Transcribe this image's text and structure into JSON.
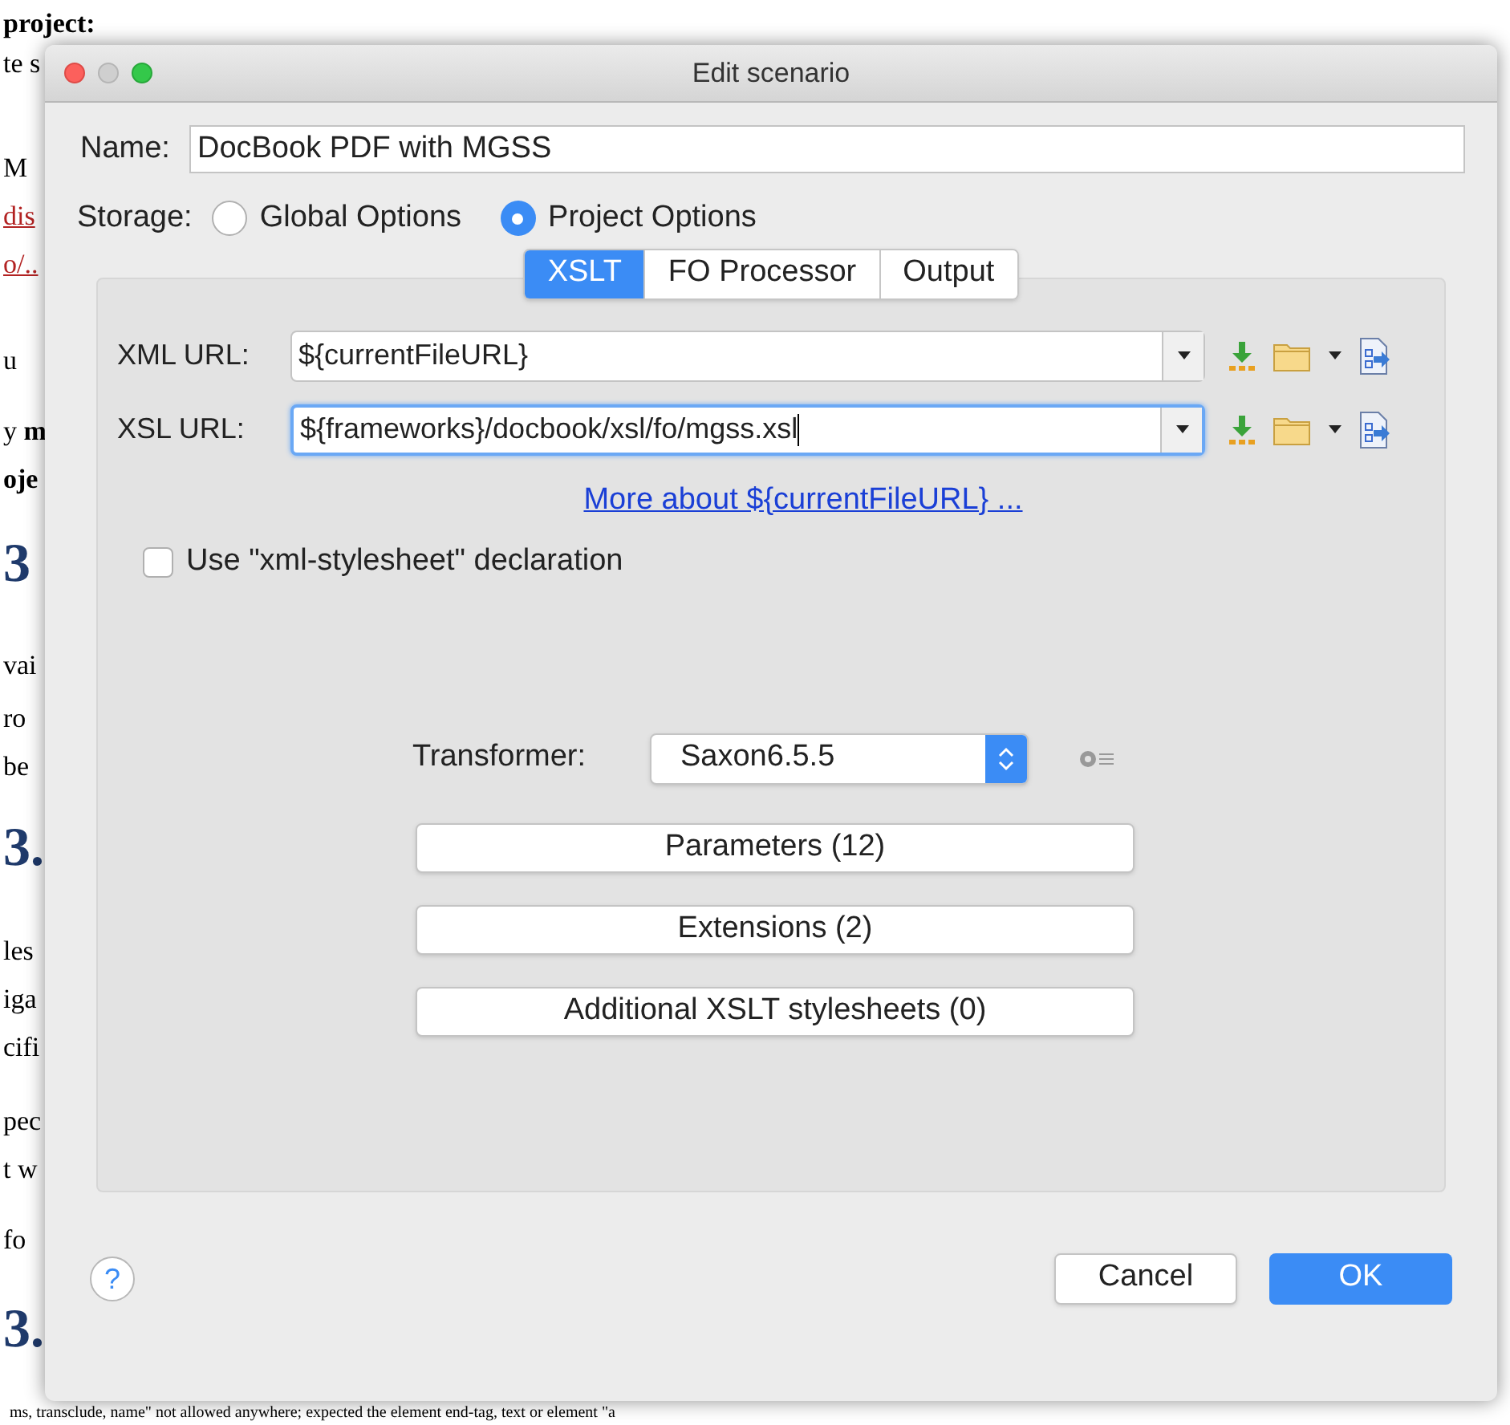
{
  "background": {
    "left_fragments": [
      {
        "text": "project:",
        "kind": "bold"
      },
      {
        "text": "te s",
        "kind": "plain"
      },
      {
        "text": "M",
        "kind": "plain"
      },
      {
        "text": "dis",
        "kind": "link"
      },
      {
        "text": "o/..",
        "kind": "link"
      },
      {
        "text": "u",
        "kind": "plain"
      },
      {
        "text": "y **m**",
        "kind": "plain"
      },
      {
        "text": "oje",
        "kind": "bold"
      },
      {
        "text": "3",
        "kind": "heading"
      },
      {
        "text": "vai",
        "kind": "plain"
      },
      {
        "text": "ro",
        "kind": "plain"
      },
      {
        "text": "be",
        "kind": "plain"
      },
      {
        "text": "3.",
        "kind": "heading"
      },
      {
        "text": "les",
        "kind": "plain"
      },
      {
        "text": "iga",
        "kind": "plain"
      },
      {
        "text": "cifi",
        "kind": "plain"
      },
      {
        "text": "pec",
        "kind": "plain"
      },
      {
        "text": "t w",
        "kind": "plain"
      },
      {
        "text": "fo",
        "kind": "plain"
      },
      {
        "text": "3.",
        "kind": "heading"
      }
    ],
    "bottom_line": "ms, transclude, name\" not allowed anywhere; expected the element end-tag, text or element \"a"
  },
  "window": {
    "title": "Edit scenario"
  },
  "name": {
    "label": "Name:",
    "value": "DocBook PDF with MGSS"
  },
  "storage": {
    "label": "Storage:",
    "options": [
      {
        "label": "Global Options",
        "selected": false
      },
      {
        "label": "Project Options",
        "selected": true
      }
    ]
  },
  "tabs": [
    {
      "label": "XSLT",
      "selected": true
    },
    {
      "label": "FO Processor",
      "selected": false
    },
    {
      "label": "Output",
      "selected": false
    }
  ],
  "urls": [
    {
      "label": "XML URL:",
      "value": "${currentFileURL}",
      "focused": false
    },
    {
      "label": "XSL URL:",
      "value": "${frameworks}/docbook/xsl/fo/mgss.xsl",
      "focused": true
    }
  ],
  "more_link": "More about ${currentFileURL} ...",
  "stylesheet_checkbox": {
    "label": "Use \"xml-stylesheet\" declaration",
    "checked": false
  },
  "transformer": {
    "label": "Transformer:",
    "value": "Saxon6.5.5"
  },
  "buttons": [
    "Parameters (12)",
    "Extensions (2)",
    "Additional XSLT stylesheets (0)"
  ],
  "footer": {
    "help": "?",
    "cancel": "Cancel",
    "ok": "OK"
  }
}
